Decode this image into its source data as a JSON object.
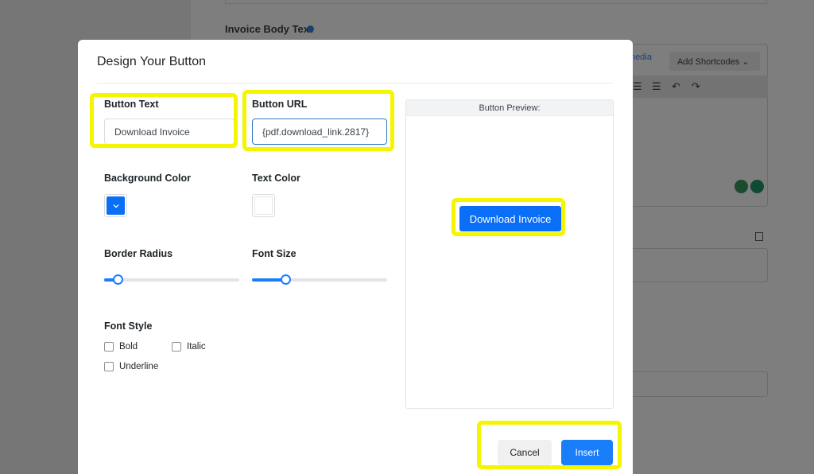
{
  "background": {
    "field_label": "Invoice Body Text",
    "media_label": "media",
    "shortcodes_label": "Add Shortcodes"
  },
  "modal": {
    "title": "Design Your Button",
    "button_text": {
      "label": "Button Text",
      "value": "Download Invoice"
    },
    "button_url": {
      "label": "Button URL",
      "value": "{pdf.download_link.2817}"
    },
    "background_color": {
      "label": "Background Color",
      "value": "#0a6ef7"
    },
    "text_color": {
      "label": "Text Color",
      "value": "#ffffff"
    },
    "border_radius": {
      "label": "Border Radius",
      "level": 0.1
    },
    "font_size": {
      "label": "Font Size",
      "level": 0.25
    },
    "font_style": {
      "label": "Font Style",
      "options": [
        {
          "label": "Bold",
          "checked": false
        },
        {
          "label": "Italic",
          "checked": false
        },
        {
          "label": "Underline",
          "checked": false
        }
      ]
    },
    "preview": {
      "header": "Button Preview:",
      "button_label": "Download Invoice"
    },
    "actions": {
      "cancel_label": "Cancel",
      "insert_label": "Insert"
    }
  },
  "colors": {
    "accent": "#1a7efb",
    "highlight": "#f5f500"
  }
}
